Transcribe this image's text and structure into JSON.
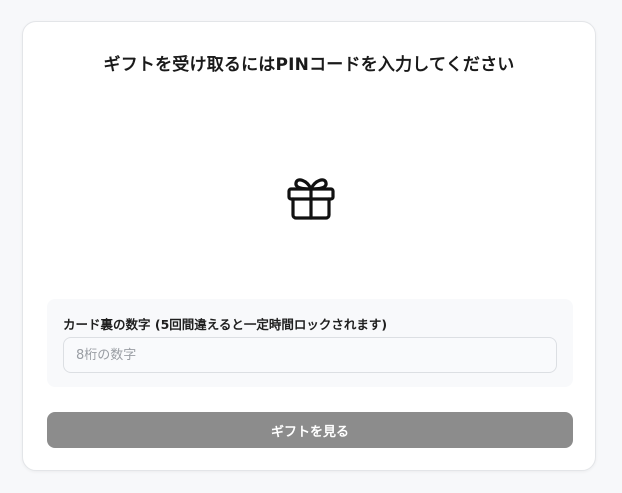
{
  "header": {
    "title": "ギフトを受け取るにはPINコードを入力してください"
  },
  "hero": {
    "icon": "gift-icon"
  },
  "pin_field": {
    "label": "カード裏の数字 (5回間違えると一定時間ロックされます)",
    "placeholder": "8桁の数字",
    "value": ""
  },
  "actions": {
    "view_gift_label": "ギフトを見る",
    "disabled_color": "#8c8c8c"
  }
}
